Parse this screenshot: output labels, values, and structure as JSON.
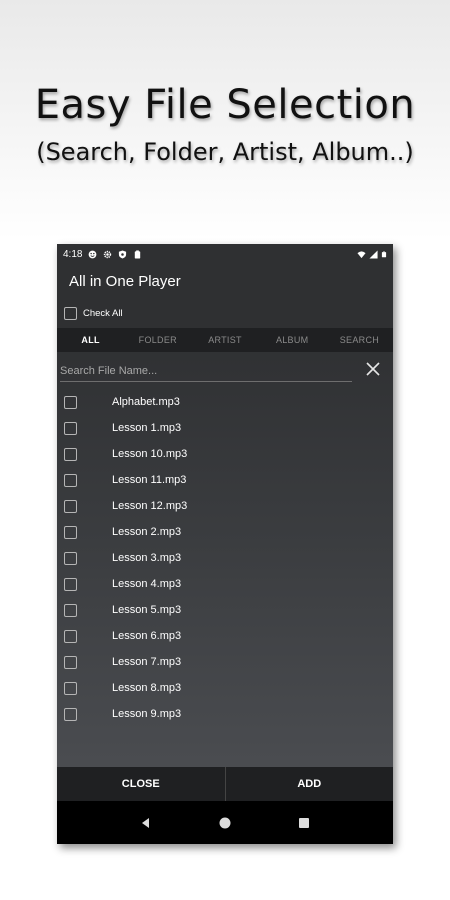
{
  "promo": {
    "headline": "Easy File Selection",
    "subline": "(Search, Folder, Artist, Album..)"
  },
  "status_bar": {
    "time": "4:18",
    "left_icons": [
      "face-icon",
      "settings-icon",
      "shield-icon",
      "clipboard-icon"
    ],
    "right_icons": [
      "wifi-icon",
      "signal-icon",
      "battery-icon"
    ]
  },
  "app": {
    "title": "All in One Player"
  },
  "check_all": {
    "label": "Check All",
    "checked": false
  },
  "tabs": [
    {
      "label": "ALL",
      "active": true
    },
    {
      "label": "FOLDER",
      "active": false
    },
    {
      "label": "ARTIST",
      "active": false
    },
    {
      "label": "ALBUM",
      "active": false
    },
    {
      "label": "SEARCH",
      "active": false
    }
  ],
  "search": {
    "placeholder": "Search File Name...",
    "value": ""
  },
  "files": [
    {
      "name": "Alphabet.mp3",
      "checked": false
    },
    {
      "name": "Lesson 1.mp3",
      "checked": false
    },
    {
      "name": "Lesson 10.mp3",
      "checked": false
    },
    {
      "name": "Lesson 11.mp3",
      "checked": false
    },
    {
      "name": "Lesson 12.mp3",
      "checked": false
    },
    {
      "name": "Lesson 2.mp3",
      "checked": false
    },
    {
      "name": "Lesson 3.mp3",
      "checked": false
    },
    {
      "name": "Lesson 4.mp3",
      "checked": false
    },
    {
      "name": "Lesson 5.mp3",
      "checked": false
    },
    {
      "name": "Lesson 6.mp3",
      "checked": false
    },
    {
      "name": "Lesson 7.mp3",
      "checked": false
    },
    {
      "name": "Lesson 8.mp3",
      "checked": false
    },
    {
      "name": "Lesson 9.mp3",
      "checked": false
    }
  ],
  "actions": {
    "close_label": "CLOSE",
    "add_label": "ADD"
  },
  "nav": {
    "icons": [
      "back-icon",
      "home-icon",
      "recents-icon"
    ]
  },
  "colors": {
    "background": "#2f3032",
    "tab_bar": "#1f2022",
    "text": "#ffffff",
    "muted_text": "#8a8a8a"
  }
}
